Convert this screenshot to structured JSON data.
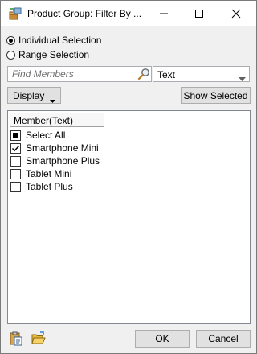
{
  "window": {
    "title": "Product Group: Filter By ...",
    "icon": "product-group-icon"
  },
  "selection_mode": {
    "options": [
      {
        "label": "Individual Selection",
        "checked": true
      },
      {
        "label": "Range Selection",
        "checked": false
      }
    ]
  },
  "search": {
    "placeholder": "Find Members",
    "value": "",
    "field": "Text"
  },
  "toolbar": {
    "display_label": "Display",
    "show_selected_label": "Show Selected"
  },
  "list": {
    "header": "Member(Text)",
    "items": [
      {
        "label": "Select All",
        "state": "partial"
      },
      {
        "label": "Smartphone Mini",
        "state": "checked"
      },
      {
        "label": "Smartphone Plus",
        "state": "unchecked"
      },
      {
        "label": "Tablet Mini",
        "state": "unchecked"
      },
      {
        "label": "Tablet Plus",
        "state": "unchecked"
      }
    ]
  },
  "footer": {
    "ok_label": "OK",
    "cancel_label": "Cancel",
    "icons": [
      "paste-clipboard-icon",
      "open-folder-icon"
    ]
  },
  "colors": {
    "button_bg": "#e1e1e1",
    "dialog_bg": "#f0f0f0",
    "border": "#adadad"
  }
}
